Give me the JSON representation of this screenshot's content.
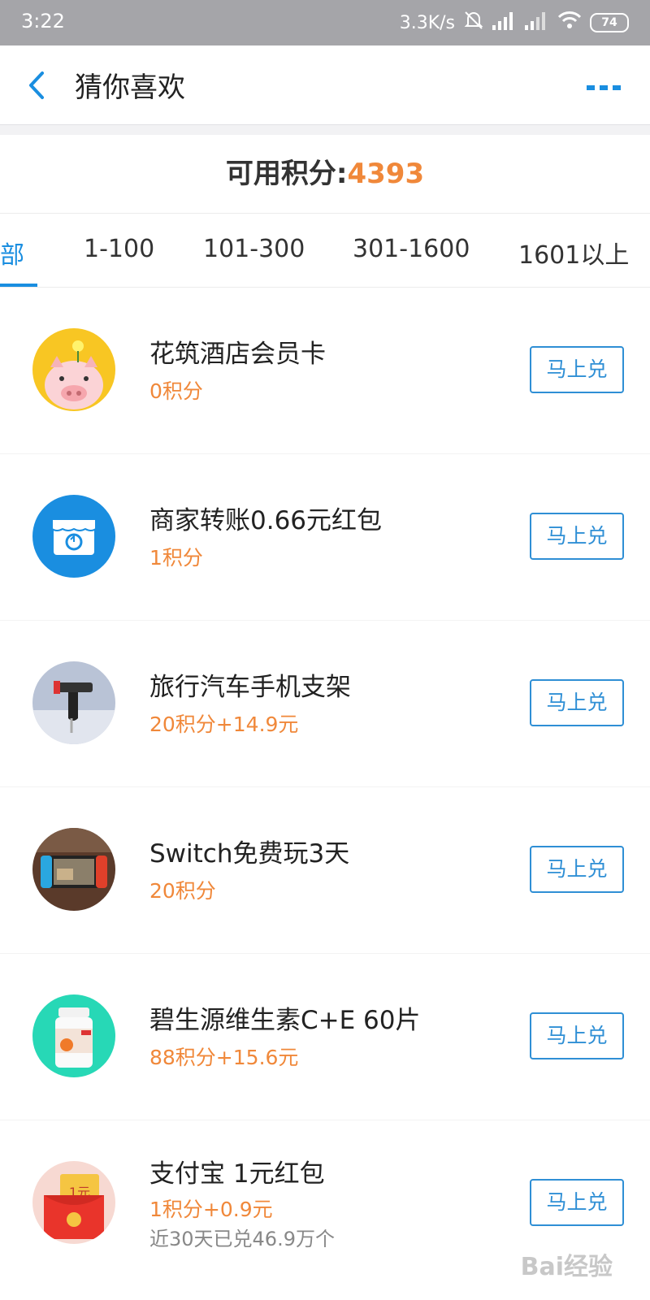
{
  "status_bar": {
    "time": "3:22",
    "speed": "3.3K/s",
    "battery": "74"
  },
  "nav": {
    "title": "猜你喜欢"
  },
  "points": {
    "label": "可用积分:",
    "value": "4393"
  },
  "tabs": [
    {
      "label": "部",
      "active": true
    },
    {
      "label": "1-100"
    },
    {
      "label": "101-300"
    },
    {
      "label": "301-1600"
    },
    {
      "label": "1601以上"
    }
  ],
  "items": [
    {
      "name": "花筑酒店会员卡",
      "price": "0积分",
      "button": "马上兑",
      "icon": "pig-icon"
    },
    {
      "name": "商家转账0.66元红包",
      "price": "1积分",
      "button": "马上兑",
      "icon": "store-icon"
    },
    {
      "name": "旅行汽车手机支架",
      "price": "20积分+14.9元",
      "button": "马上兑",
      "icon": "phone-holder-icon"
    },
    {
      "name": "Switch免费玩3天",
      "price": "20积分",
      "button": "马上兑",
      "icon": "game-console-icon"
    },
    {
      "name": "碧生源维生素C+E 60片",
      "price": "88积分+15.6元",
      "button": "马上兑",
      "icon": "vitamin-bottle-icon"
    },
    {
      "name": "支付宝 1元红包",
      "price": "1积分+0.9元",
      "sub": "近30天已兑46.9万个",
      "button": "马上兑",
      "icon": "red-envelope-icon",
      "icon_text": "1元"
    }
  ],
  "watermark": "Bai经验"
}
